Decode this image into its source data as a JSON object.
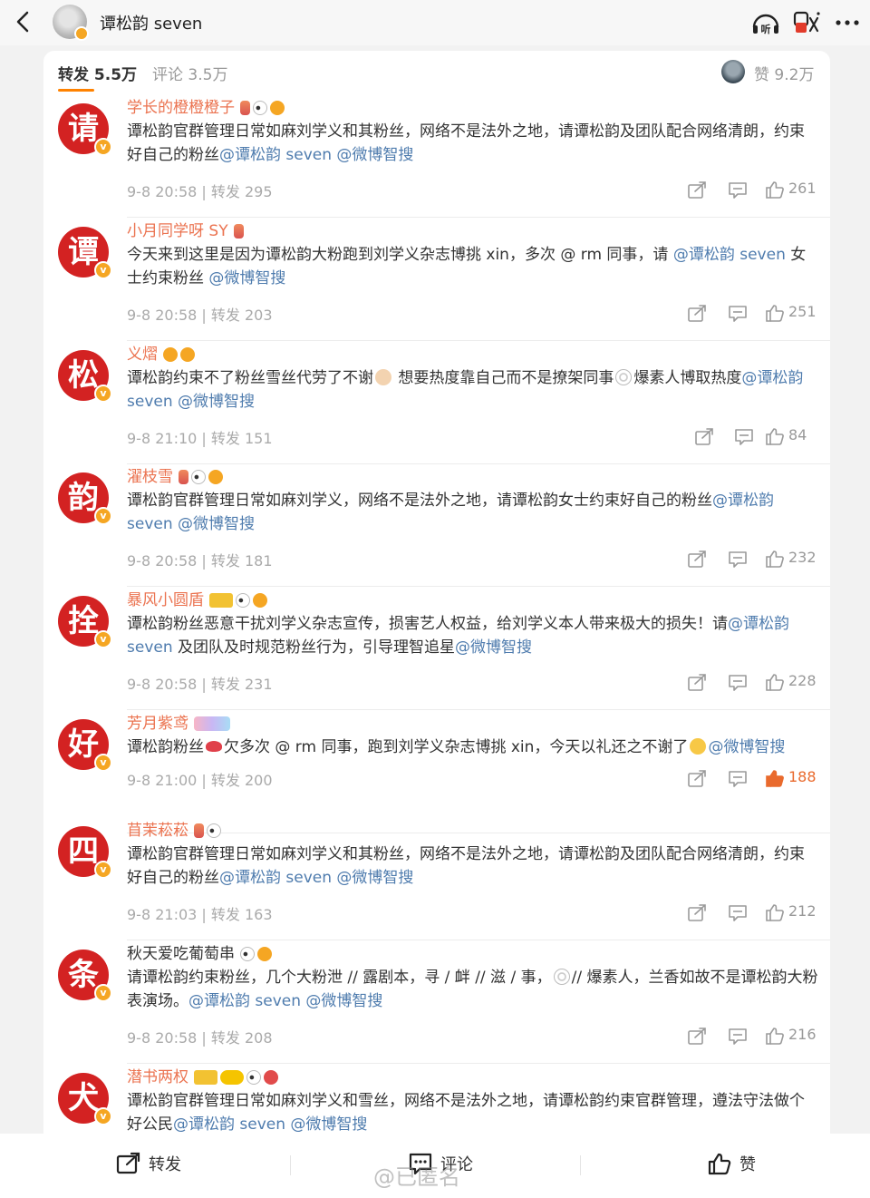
{
  "header": {
    "title": "谭松韵 seven",
    "icons": [
      "back-icon",
      "listen-icon",
      "translate-icon",
      "more-icon"
    ],
    "listen_label": "听"
  },
  "tabs": {
    "forward": "转发 5.5万",
    "comment": "评论 3.5万",
    "likes": "赞 9.2万"
  },
  "reposts": [
    {
      "avatar_char": "请",
      "name": "学长的橙橙橙子",
      "name_color": "#eb7350",
      "badges": [
        "hourglass",
        "panda",
        "cookie"
      ],
      "segments": [
        {
          "t": "谭松韵官群管理日常如麻刘学义和其粉丝，网络不是法外之地，请谭松韵及团队配合网络清朗，约束好自己的粉丝"
        },
        {
          "t": "@谭松韵 seven",
          "m": true
        },
        {
          "t": " "
        },
        {
          "t": "@微博智搜",
          "m": true
        }
      ],
      "meta": "9-8 20:58 | 转发 295",
      "likes": "261",
      "liked": false
    },
    {
      "avatar_char": "谭",
      "name": "小月同学呀 SY",
      "name_color": "#eb7350",
      "badges": [
        "hourglass"
      ],
      "segments": [
        {
          "t": "今天来到这里是因为谭松韵大粉跑到刘学义杂志博挑 xin，多次 @ rm 同事，请 "
        },
        {
          "t": "@谭松韵 seven",
          "m": true
        },
        {
          "t": " 女士约束粉丝 "
        },
        {
          "t": "@微博智搜",
          "m": true
        }
      ],
      "meta": "9-8 20:58 | 转发 203",
      "likes": "251",
      "liked": false
    },
    {
      "avatar_char": "松",
      "name": "义熠",
      "name_color": "#eb7350",
      "badges": [
        "cookie",
        "cookie"
      ],
      "segments": [
        {
          "t": "谭松韵约束不了粉丝雪丝代劳了不谢"
        },
        {
          "i": "hand"
        },
        {
          "t": " 想要热度靠自己而不是撩架同事"
        },
        {
          "i": "web"
        },
        {
          "t": "爆素人博取热度"
        },
        {
          "t": "@谭松韵 seven",
          "m": true
        },
        {
          "t": " "
        },
        {
          "t": "@微博智搜",
          "m": true
        }
      ],
      "meta": "9-8 21:10 | 转发 151",
      "likes": "84",
      "liked": false
    },
    {
      "avatar_char": "韵",
      "name": "濯枝雪",
      "name_color": "#eb7350",
      "badges": [
        "hourglass",
        "panda",
        "cookie"
      ],
      "segments": [
        {
          "t": "谭松韵官群管理日常如麻刘学义，网络不是法外之地，请谭松韵女士约束好自己的粉丝"
        },
        {
          "t": "@谭松韵 seven",
          "m": true
        },
        {
          "t": " "
        },
        {
          "t": "@微博智搜",
          "m": true
        }
      ],
      "meta": "9-8 20:58 | 转发 181",
      "likes": "232",
      "liked": false
    },
    {
      "avatar_char": "拴",
      "name": "暴风小圆盾",
      "name_color": "#eb7350",
      "badges": [
        "crown",
        "panda",
        "cookie"
      ],
      "segments": [
        {
          "t": "谭松韵粉丝恶意干扰刘学义杂志宣传，损害艺人权益，给刘学义本人带来极大的损失！请"
        },
        {
          "t": "@谭松韵 seven",
          "m": true
        },
        {
          "t": " 及团队及时规范粉丝行为，引导理智追星"
        },
        {
          "t": "@微博智搜",
          "m": true
        }
      ],
      "meta": "9-8 20:58 | 转发 231",
      "likes": "228",
      "liked": false
    },
    {
      "avatar_char": "好",
      "name": "芳月紫鸢",
      "name_color": "#eb7350",
      "badges": [
        "rainbow"
      ],
      "segments": [
        {
          "t": "谭松韵粉丝"
        },
        {
          "i": "lips"
        },
        {
          "t": "欠多次 @ rm 同事，跑到刘学义杂志博挑 xin，今天以礼还之不谢了"
        },
        {
          "i": "wave"
        },
        {
          "t": "@微博智搜",
          "m": true
        }
      ],
      "meta": "9-8 21:00 | 转发 200",
      "likes": "188",
      "liked": true
    },
    {
      "avatar_char": "四",
      "name": "苜茉菘菘",
      "name_color": "#eb7350",
      "badges": [
        "hourglass",
        "panda"
      ],
      "segments": [
        {
          "t": "谭松韵官群管理日常如麻刘学义和其粉丝，网络不是法外之地，请谭松韵及团队配合网络清朗，约束好自己的粉丝"
        },
        {
          "t": "@谭松韵 seven",
          "m": true
        },
        {
          "t": " "
        },
        {
          "t": "@微博智搜",
          "m": true
        }
      ],
      "meta": "9-8 21:03 | 转发 163",
      "likes": "212",
      "liked": false
    },
    {
      "avatar_char": "条",
      "name": "秋天爱吃葡萄串",
      "name_color": "#333333",
      "badges": [
        "panda",
        "cookie"
      ],
      "segments": [
        {
          "t": "请谭松韵约束粉丝，几个大粉泄 // 露剧本，寻 / 衅 // 滋 / 事，"
        },
        {
          "i": "web"
        },
        {
          "t": "// 爆素人，兰香如故不是谭松韵大粉表演场。"
        },
        {
          "t": "@谭松韵 seven",
          "m": true
        },
        {
          "t": " "
        },
        {
          "t": "@微博智搜",
          "m": true
        }
      ],
      "meta": "9-8 20:58 | 转发 208",
      "likes": "216",
      "liked": false
    },
    {
      "avatar_char": "犬",
      "name": "潜书两权",
      "name_color": "#eb7350",
      "badges": [
        "crown",
        "lv",
        "panda",
        "rose"
      ],
      "segments": [
        {
          "t": "谭松韵官群管理日常如麻刘学义和雪丝，网络不是法外之地，请谭松韵约束官群管理，遵法守法做个好公民"
        },
        {
          "t": "@谭松韵 seven",
          "m": true
        },
        {
          "t": " "
        },
        {
          "t": "@微博智搜",
          "m": true
        }
      ],
      "meta": "",
      "likes": "",
      "liked": false
    }
  ],
  "bottom_bar": {
    "forward": "转发",
    "comment": "评论",
    "like": "赞"
  },
  "watermark": "@已匿名",
  "colors": {
    "accent": "#ff8200",
    "name": "#eb7350",
    "mention": "#4f7cae",
    "avatar_bg": "#d32222"
  }
}
